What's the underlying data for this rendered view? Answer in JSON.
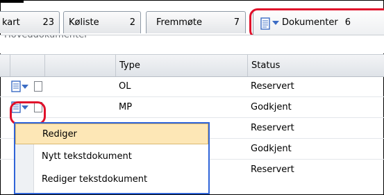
{
  "tabs": [
    {
      "label": "kart",
      "count": "23"
    },
    {
      "label": "Køliste",
      "count": "2"
    },
    {
      "label": "Fremmøte",
      "count": "7"
    },
    {
      "label": "Dokumenter",
      "count": "6"
    }
  ],
  "subtitle": "Hoveddokumenter",
  "grid": {
    "columns": [
      "Type",
      "Status"
    ],
    "rows": [
      {
        "type": "OL",
        "status": "Reservert"
      },
      {
        "type": "MP",
        "status": "Godkjent"
      },
      {
        "type": "",
        "status": "Reservert"
      },
      {
        "type": "",
        "status": "Godkjent"
      },
      {
        "type": "",
        "status": "Reservert"
      }
    ]
  },
  "menu": {
    "items": [
      "Rediger",
      "Nytt tekstdokument",
      "Rediger tekstdokument"
    ],
    "active_index": 0
  },
  "colors": {
    "highlight": "#e0102a",
    "menu_border": "#2f64d8",
    "menu_active": "#fde7b6"
  }
}
